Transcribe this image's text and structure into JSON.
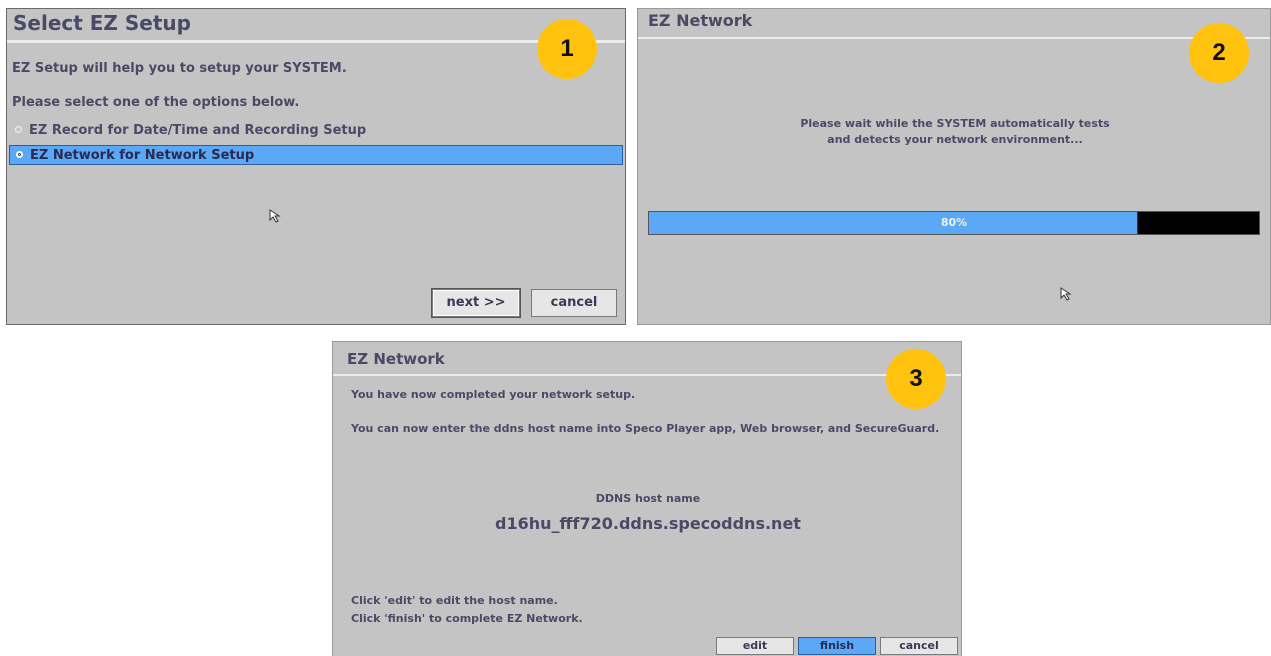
{
  "panel1": {
    "title": "Select  EZ  Setup",
    "badge": "1",
    "intro": "EZ Setup will help you to setup your SYSTEM.",
    "prompt": "Please select one of the options below.",
    "options": [
      {
        "label": "EZ Record for Date/Time and Recording Setup",
        "selected": false
      },
      {
        "label": "EZ Network for Network Setup",
        "selected": true
      }
    ],
    "next_label": "next >>",
    "cancel_label": "cancel"
  },
  "panel2": {
    "title": "EZ  Network",
    "badge": "2",
    "message_line1": "Please wait while the SYSTEM automatically tests",
    "message_line2": "and detects your network environment...",
    "progress_value": 0.8,
    "progress_label": "80%"
  },
  "panel3": {
    "title": "EZ  Network",
    "badge": "3",
    "line1": "You have now completed your network setup.",
    "line2": "You can now enter the ddns host name into Speco Player app, Web browser, and SecureGuard.",
    "ddns_label": "DDNS host name",
    "ddns_value": "d16hu_fff720.ddns.specoddns.net",
    "hint1": "Click 'edit' to edit the host name.",
    "hint2": "Click 'finish' to complete EZ Network.",
    "edit_label": "edit",
    "finish_label": "finish",
    "cancel_label": "cancel"
  },
  "colors": {
    "panel_bg": "#c4c4c4",
    "highlight": "#5aa8f6",
    "badge": "#ffc20e",
    "text": "#4a4a66"
  }
}
